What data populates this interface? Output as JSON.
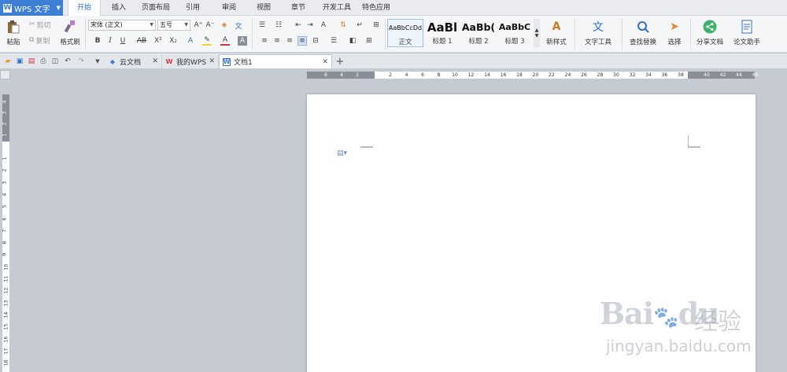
{
  "app": {
    "logo_text": "WPS 文字"
  },
  "menu_tabs": [
    "开始",
    "插入",
    "页面布局",
    "引用",
    "审阅",
    "视图",
    "章节",
    "开发工具",
    "特色应用"
  ],
  "clipboard": {
    "paste": "粘贴",
    "cut": "剪切",
    "copy": "复制",
    "format_painter": "格式刷"
  },
  "font": {
    "family": "宋体 (正文)",
    "size": "五号"
  },
  "styles": [
    {
      "preview": "AaBbCcDd",
      "label": "正文"
    },
    {
      "preview": "AaBl",
      "label": "标题 1"
    },
    {
      "preview": "AaBb(",
      "label": "标题 2"
    },
    {
      "preview": "AaBbC",
      "label": "标题 3"
    }
  ],
  "ribbon_buttons": {
    "new_style": "新样式",
    "text_tools": "文字工具",
    "find_replace": "查找替换",
    "select": "选择",
    "share_doc": "分享文档",
    "thesis_helper": "论文助手"
  },
  "doc_tabs": [
    {
      "label": "云文档",
      "icon": "cloud-cube-icon",
      "color": "#3a7bd5"
    },
    {
      "label": "我的WPS",
      "icon": "wps-logo-icon",
      "color": "#d9363e"
    },
    {
      "label": "文档1",
      "icon": "document-icon",
      "color": "#3a7bd5"
    }
  ],
  "ruler": {
    "h_ticks_left": [
      "6",
      "4",
      "2"
    ],
    "h_ticks_main": [
      "2",
      "4",
      "6",
      "8",
      "10",
      "12",
      "14",
      "16",
      "18",
      "20",
      "22",
      "24",
      "26",
      "28",
      "30",
      "32",
      "34",
      "36",
      "38"
    ],
    "h_ticks_right": [
      "40",
      "42",
      "44",
      "46"
    ],
    "v_ticks_top": [
      "4",
      "3",
      "2",
      "1"
    ],
    "v_ticks_main": [
      "1",
      "2",
      "3",
      "4",
      "5",
      "6",
      "7",
      "8",
      "9",
      "10",
      "11",
      "12",
      "13",
      "14",
      "15",
      "16",
      "17",
      "18"
    ]
  },
  "watermark": {
    "brand": "Bai",
    "brand2": "du",
    "cn": "经验",
    "url": "jingyan.baidu.com"
  },
  "colors": {
    "accent": "#2b6fd0",
    "logo_bg": "#3c7fd5",
    "workspace": "#c6cad3",
    "share_green": "#3eb26a"
  }
}
